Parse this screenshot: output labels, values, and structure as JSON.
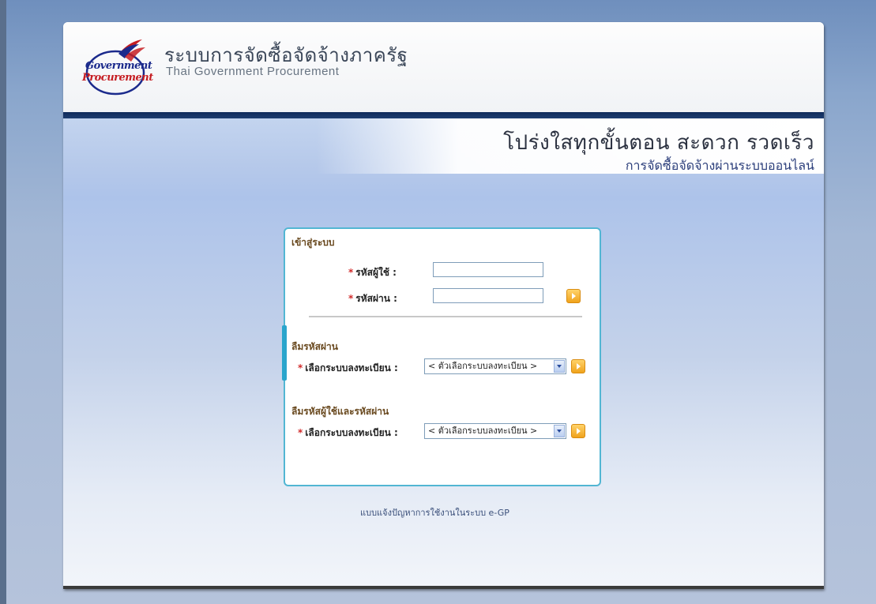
{
  "header": {
    "logo_line1": "Government",
    "logo_line2": "Procurement",
    "title": "ระบบการจัดซื้อจัดจ้างภาครัฐ",
    "subtitle": "Thai Government Procurement"
  },
  "banner": {
    "slogan": "โปร่งใสทุกขั้นตอน  สะดวก  รวดเร็ว",
    "tagline": "การจัดซื้อจัดจ้างผ่านระบบออนไลน์"
  },
  "login": {
    "section_title": "เข้าสู่ระบบ",
    "username_label": "รหัสผู้ใช้ :",
    "username_value": "",
    "password_label": "รหัสผ่าน :",
    "password_value": ""
  },
  "forgot_password": {
    "section_title": "ลืมรหัสผ่าน",
    "select_label": "เลือกระบบลงทะเบียน :",
    "select_value": "< ตัวเลือกระบบลงทะเบียน >"
  },
  "forgot_user_password": {
    "section_title": "ลืมรหัสผู้ใช้และรหัสผ่าน",
    "select_label": "เลือกระบบลงทะเบียน :",
    "select_value": "< ตัวเลือกระบบลงทะเบียน >"
  },
  "required_mark": "*",
  "footer_link": "แบบแจ้งปัญหาการใช้งานในระบบ e-GP",
  "colors": {
    "header_bar": "#0f2b5b",
    "box_border": "#52b6d3",
    "go_button": "#f0a21c",
    "section_title": "#6a4a20"
  }
}
